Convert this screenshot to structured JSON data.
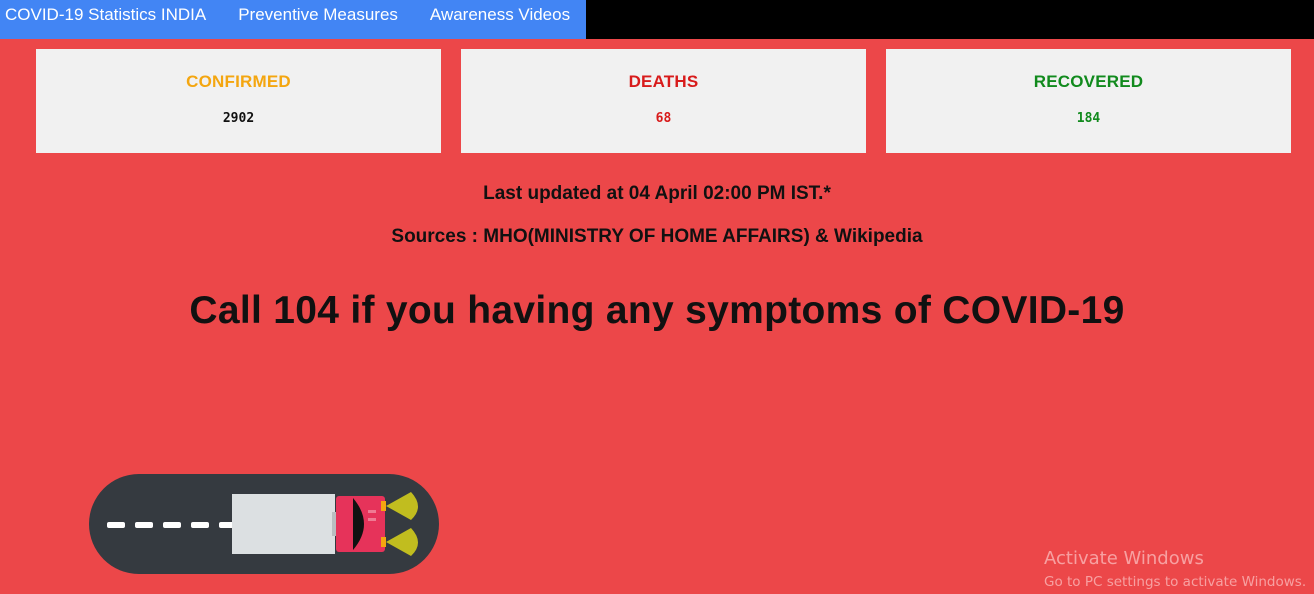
{
  "nav": {
    "items": [
      "COVID-19 Statistics INDIA",
      "Preventive Measures",
      "Awareness Videos"
    ]
  },
  "stats": {
    "confirmed": {
      "label": "CONFIRMED",
      "value": "2902",
      "color": "#f4a610"
    },
    "deaths": {
      "label": "DEATHS",
      "value": "68",
      "color": "#d81b1b"
    },
    "recovered": {
      "label": "RECOVERED",
      "value": "184",
      "color": "#118a1d"
    }
  },
  "info": {
    "last_updated": "Last updated at 04 April 02:00 PM IST.*",
    "sources": "Sources : MHO(MINISTRY OF HOME AFFAIRS) & Wikipedia",
    "callout": "Call 104 if you having any symptoms of COVID-19"
  },
  "illustration": {
    "icon": "ambulance-on-road-icon",
    "road_color": "#353a40",
    "vehicle_body_color": "#dce0e2",
    "cab_color": "#e6335a",
    "headlight_color": "#d9d51a"
  },
  "watermark": {
    "title": "Activate Windows",
    "subtitle": "Go to PC settings to activate Windows."
  }
}
